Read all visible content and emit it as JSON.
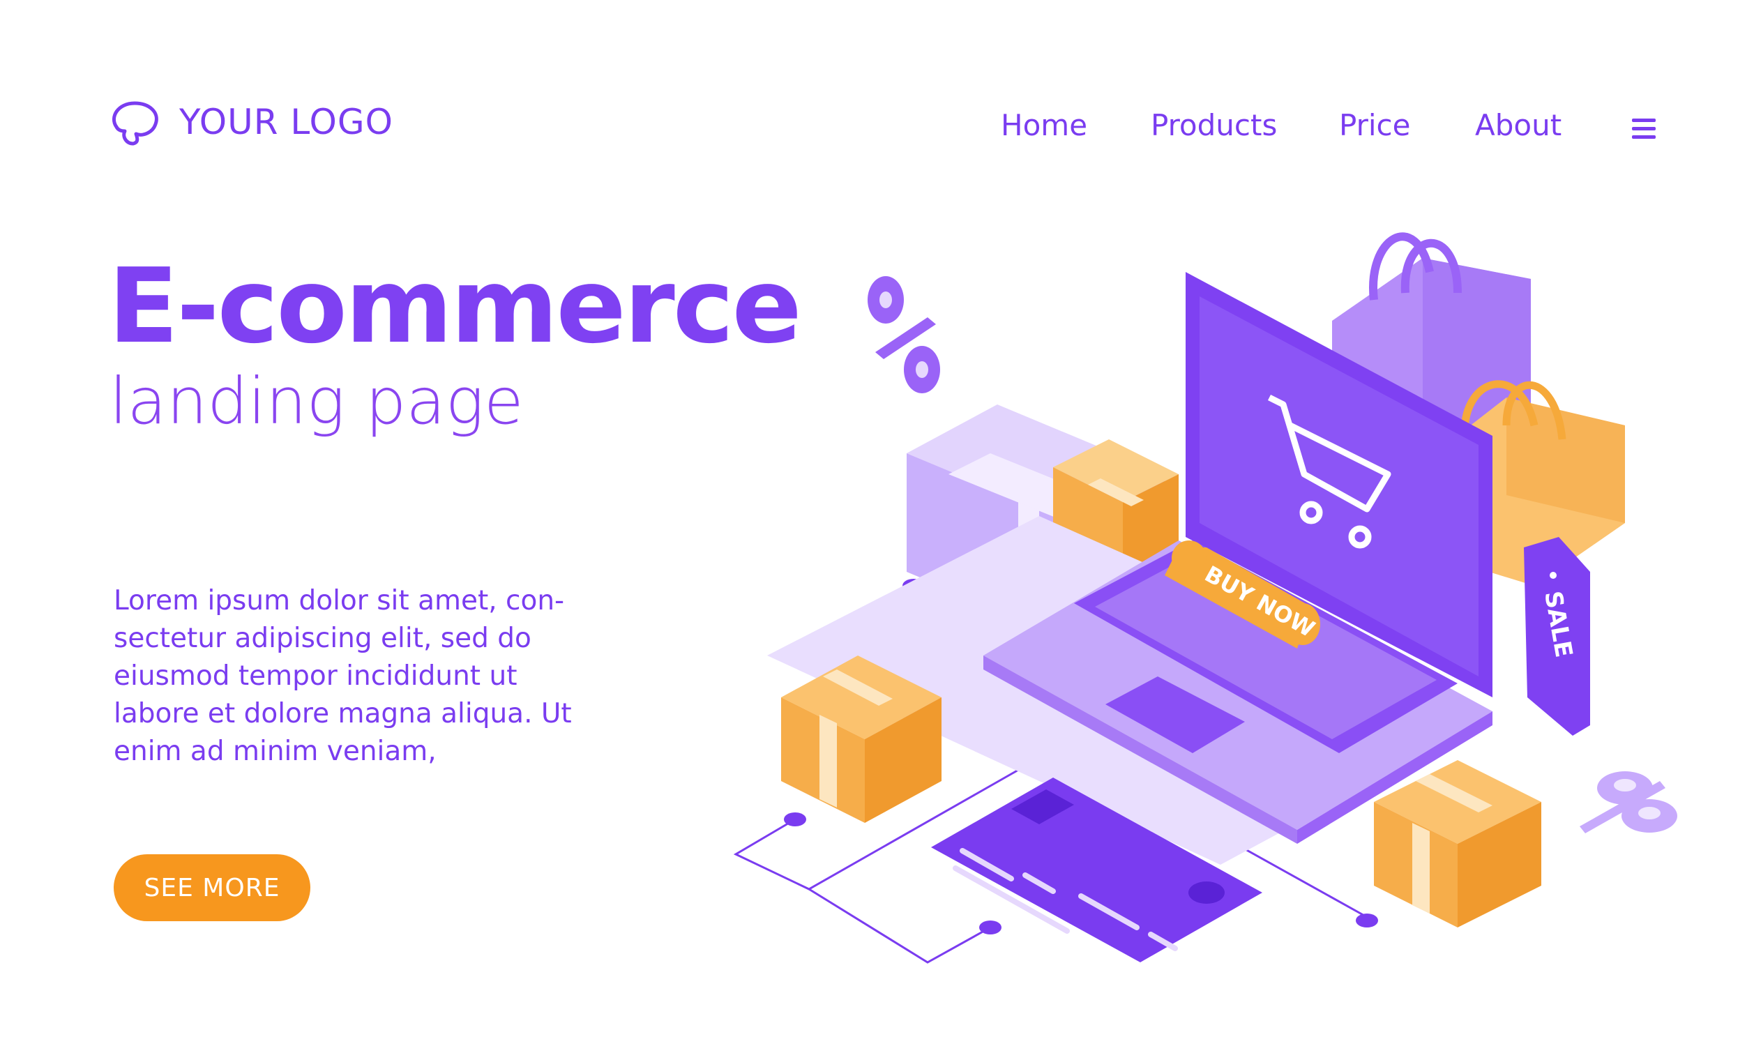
{
  "header": {
    "logo_text": "YOUR LOGO",
    "nav": [
      {
        "label": "Home"
      },
      {
        "label": "Products"
      },
      {
        "label": "Price"
      },
      {
        "label": "About"
      }
    ]
  },
  "hero": {
    "title": "E-commerce",
    "subtitle": "landing page",
    "body_lines": [
      "Lorem ipsum dolor sit amet, con-",
      "sectetur adipiscing elit, sed do",
      "eiusmod tempor incididunt ut",
      "labore et dolore magna aliqua. Ut",
      "enim ad minim veniam,"
    ],
    "cta_label": "SEE MORE"
  },
  "illustration": {
    "buy_now_label": "BUY NOW",
    "sale_tag_label": "SALE",
    "percent_symbol": "%"
  },
  "colors": {
    "primary": "#7a3cf0",
    "accent": "#f7971e",
    "light_purple": "#c2a6fb",
    "orange_box": "#f6ad4a"
  },
  "icons": [
    "logo-icon",
    "menu-icon",
    "shopping-cart-icon",
    "percent-icon"
  ]
}
